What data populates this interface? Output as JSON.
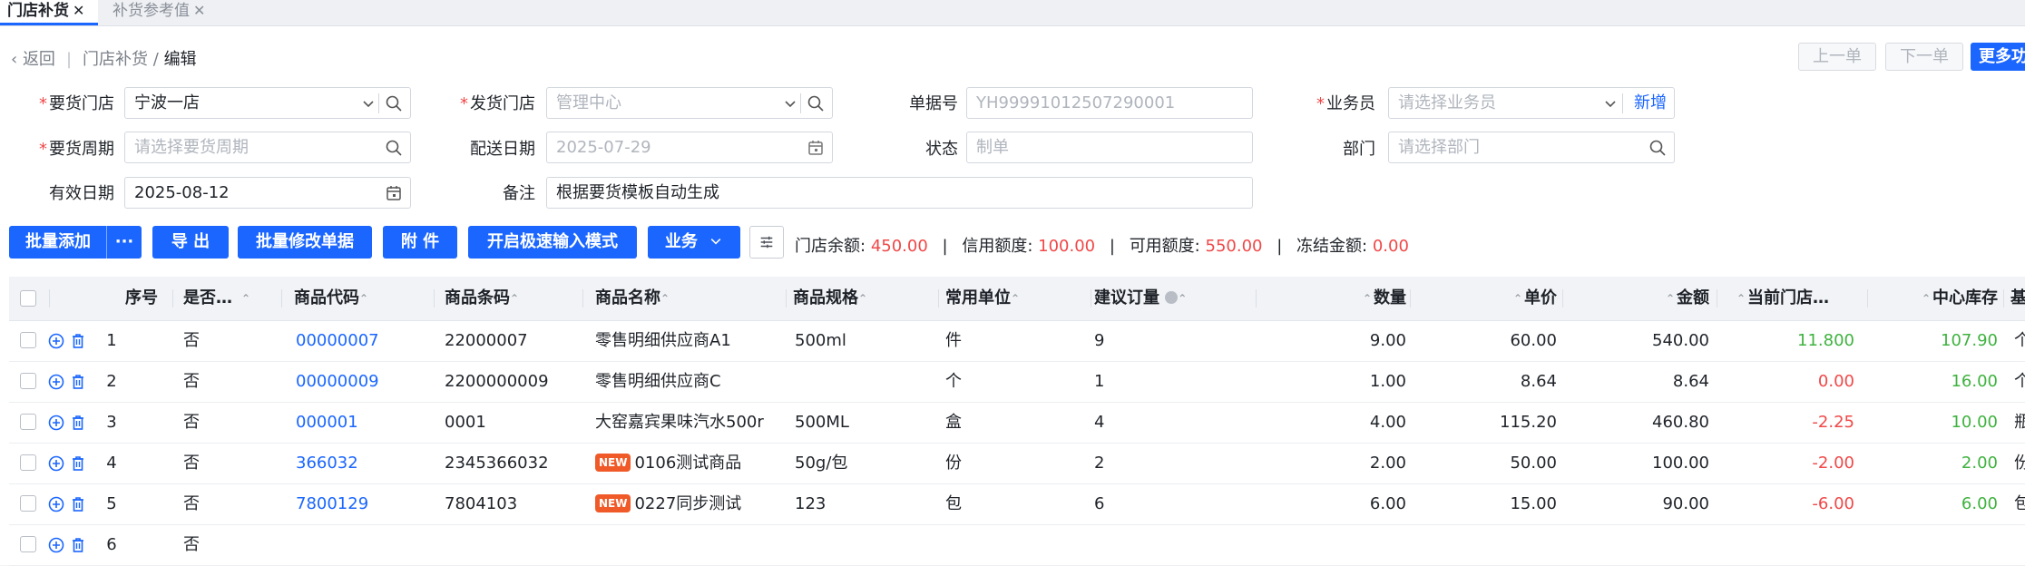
{
  "tabs": [
    {
      "label": "门店补货",
      "close": "✕",
      "active": true
    },
    {
      "label": "补货参考值",
      "close": "✕",
      "active": false
    }
  ],
  "breadcrumb": {
    "back": "返回",
    "parent": "门店补货",
    "sep": "/",
    "current": "编辑"
  },
  "nav_buttons": {
    "prev": "上一单",
    "next": "下一单",
    "more": "更多功"
  },
  "form": {
    "store_label": "要货门店",
    "store_value": "宁波一店",
    "ship_store_label": "发货门店",
    "ship_store_placeholder": "管理中心",
    "doc_no_label": "单据号",
    "doc_no_value": "YH99991012507290001",
    "salesman_label": "业务员",
    "salesman_placeholder": "请选择业务员",
    "salesman_add": "新增",
    "period_label": "要货周期",
    "period_placeholder": "请选择要货周期",
    "delivery_label": "配送日期",
    "delivery_value": "2025-07-29",
    "status_label": "状态",
    "status_value": "制单",
    "dept_label": "部门",
    "dept_placeholder": "请选择部门",
    "valid_label": "有效日期",
    "valid_value": "2025-08-12",
    "remark_label": "备注",
    "remark_value": "根据要货模板自动生成"
  },
  "toolbar": {
    "batch_add": "批量添加",
    "batch_add_more": "···",
    "export": "导 出",
    "batch_edit": "批量修改单据",
    "attach": "附 件",
    "fast_input": "开启极速输入模式",
    "business": "业务"
  },
  "balance": {
    "store_balance_label": "门店余额:",
    "store_balance": "450.00",
    "credit_label": "信用额度:",
    "credit": "100.00",
    "available_label": "可用额度:",
    "available": "550.00",
    "frozen_label": "冻结金额:",
    "frozen": "0.00",
    "divider": "|"
  },
  "table": {
    "headers": {
      "seq": "序号",
      "is_gift": "是否…",
      "code": "商品代码",
      "barcode": "商品条码",
      "name": "商品名称",
      "spec": "商品规格",
      "unit": "常用单位",
      "suggest": "建议订量",
      "qty": "数量",
      "price": "单价",
      "amount": "金额",
      "store_stock": "当前门店…",
      "center_stock": "中心库存",
      "extra": "基"
    },
    "new_badge": "NEW",
    "rows": [
      {
        "seq": "1",
        "gift": "否",
        "code": "00000007",
        "barcode": "22000007",
        "name": "零售明细供应商A1",
        "is_new": false,
        "spec": "500ml",
        "unit": "件",
        "suggest": "9",
        "qty": "9.00",
        "price": "60.00",
        "amount": "540.00",
        "store_stock": "11.800",
        "center_stock": "107.90",
        "extra": "个",
        "store_neg": false
      },
      {
        "seq": "2",
        "gift": "否",
        "code": "00000009",
        "barcode": "2200000009",
        "name": "零售明细供应商C",
        "is_new": false,
        "spec": "",
        "unit": "个",
        "suggest": "1",
        "qty": "1.00",
        "price": "8.64",
        "amount": "8.64",
        "store_stock": "0.00",
        "center_stock": "16.00",
        "extra": "个",
        "store_neg": true
      },
      {
        "seq": "3",
        "gift": "否",
        "code": "000001",
        "barcode": "0001",
        "name": "大窑嘉宾果味汽水500r",
        "is_new": false,
        "spec": "500ML",
        "unit": "盒",
        "suggest": "4",
        "qty": "4.00",
        "price": "115.20",
        "amount": "460.80",
        "store_stock": "-2.25",
        "center_stock": "10.00",
        "extra": "瓶",
        "store_neg": true
      },
      {
        "seq": "4",
        "gift": "否",
        "code": "366032",
        "barcode": "2345366032",
        "name": "0106测试商品",
        "is_new": true,
        "spec": "50g/包",
        "unit": "份",
        "suggest": "2",
        "qty": "2.00",
        "price": "50.00",
        "amount": "100.00",
        "store_stock": "-2.00",
        "center_stock": "2.00",
        "extra": "份",
        "store_neg": true
      },
      {
        "seq": "5",
        "gift": "否",
        "code": "7800129",
        "barcode": "7804103",
        "name": "0227同步测试",
        "is_new": true,
        "spec": "123",
        "unit": "包",
        "suggest": "6",
        "qty": "6.00",
        "price": "15.00",
        "amount": "90.00",
        "store_stock": "-6.00",
        "center_stock": "6.00",
        "extra": "包",
        "store_neg": true
      },
      {
        "seq": "6",
        "gift": "否",
        "code": "",
        "barcode": "",
        "name": "",
        "is_new": false,
        "spec": "",
        "unit": "",
        "suggest": "",
        "qty": "",
        "price": "",
        "amount": "",
        "store_stock": "",
        "center_stock": "",
        "extra": "",
        "store_neg": false
      }
    ]
  },
  "colors": {
    "primary": "#1a66ff",
    "danger": "#f04848",
    "success": "#3fb23f",
    "new_badge": "#f05a28"
  }
}
